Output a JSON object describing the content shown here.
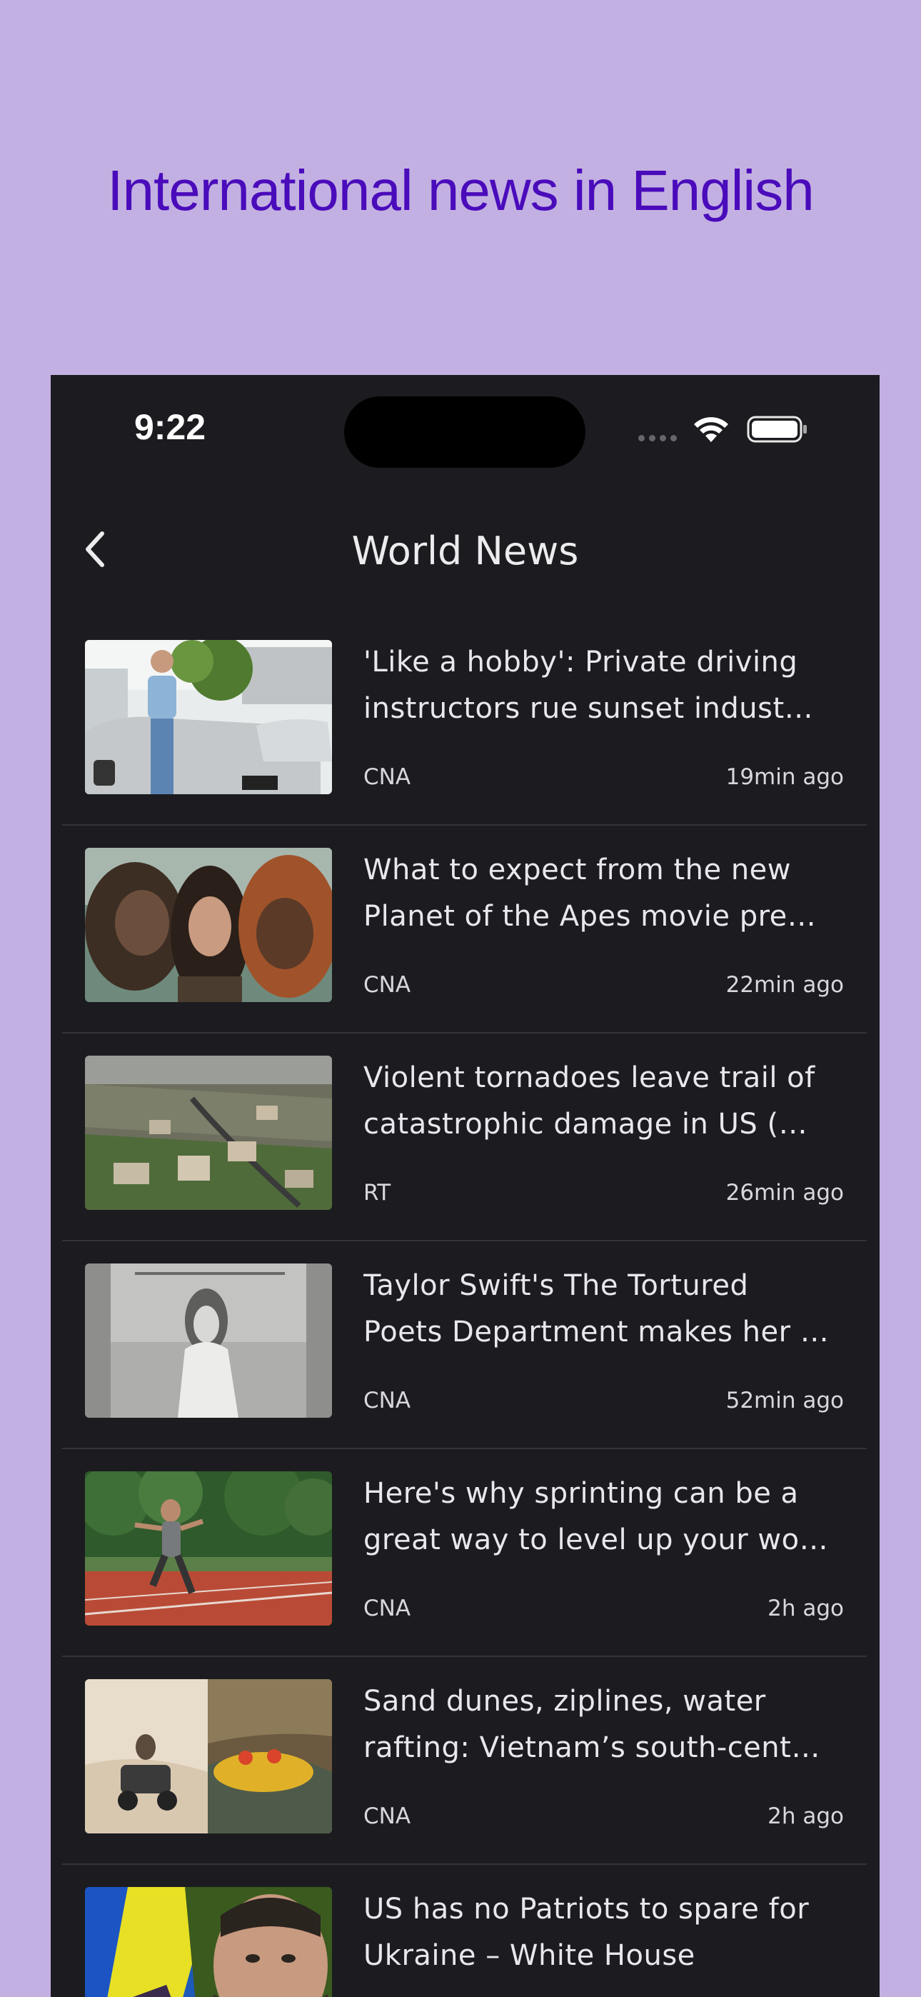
{
  "promo": {
    "headline": "International news in English"
  },
  "status_bar": {
    "time": "9:22"
  },
  "nav": {
    "title": "World News"
  },
  "articles": [
    {
      "title_line1": "'Like a hobby': Private driving",
      "title_line2": "instructors rue sunset indust…",
      "source": "CNA",
      "time": "19min ago"
    },
    {
      "title_line1": "What to expect from the new",
      "title_line2": "Planet of the Apes movie pre…",
      "source": "CNA",
      "time": "22min ago"
    },
    {
      "title_line1": "Violent tornadoes leave trail of",
      "title_line2": "catastrophic damage in US (…",
      "source": "RT",
      "time": "26min ago"
    },
    {
      "title_line1": "Taylor Swift's The Tortured",
      "title_line2": "Poets Department makes her …",
      "source": "CNA",
      "time": "52min ago"
    },
    {
      "title_line1": "Here's why sprinting can be a",
      "title_line2": "great way to level up your wo…",
      "source": "CNA",
      "time": "2h ago"
    },
    {
      "title_line1": "Sand dunes, ziplines, water",
      "title_line2": "rafting: Vietnam’s south-cent…",
      "source": "CNA",
      "time": "2h ago"
    },
    {
      "title_line1": "US has no Patriots to spare for",
      "title_line2": "Ukraine – White House",
      "source": "",
      "time": ""
    }
  ],
  "icons": {
    "back": "chevron-left-icon",
    "wifi": "wifi-icon",
    "battery": "battery-icon",
    "signal": "signal-dots-icon"
  },
  "colors": {
    "page_background": "#c3b0e2",
    "headline": "#4a0bbb",
    "screen_background": "#1c1c20",
    "text": "#e8e8ec",
    "divider": "#333338"
  }
}
